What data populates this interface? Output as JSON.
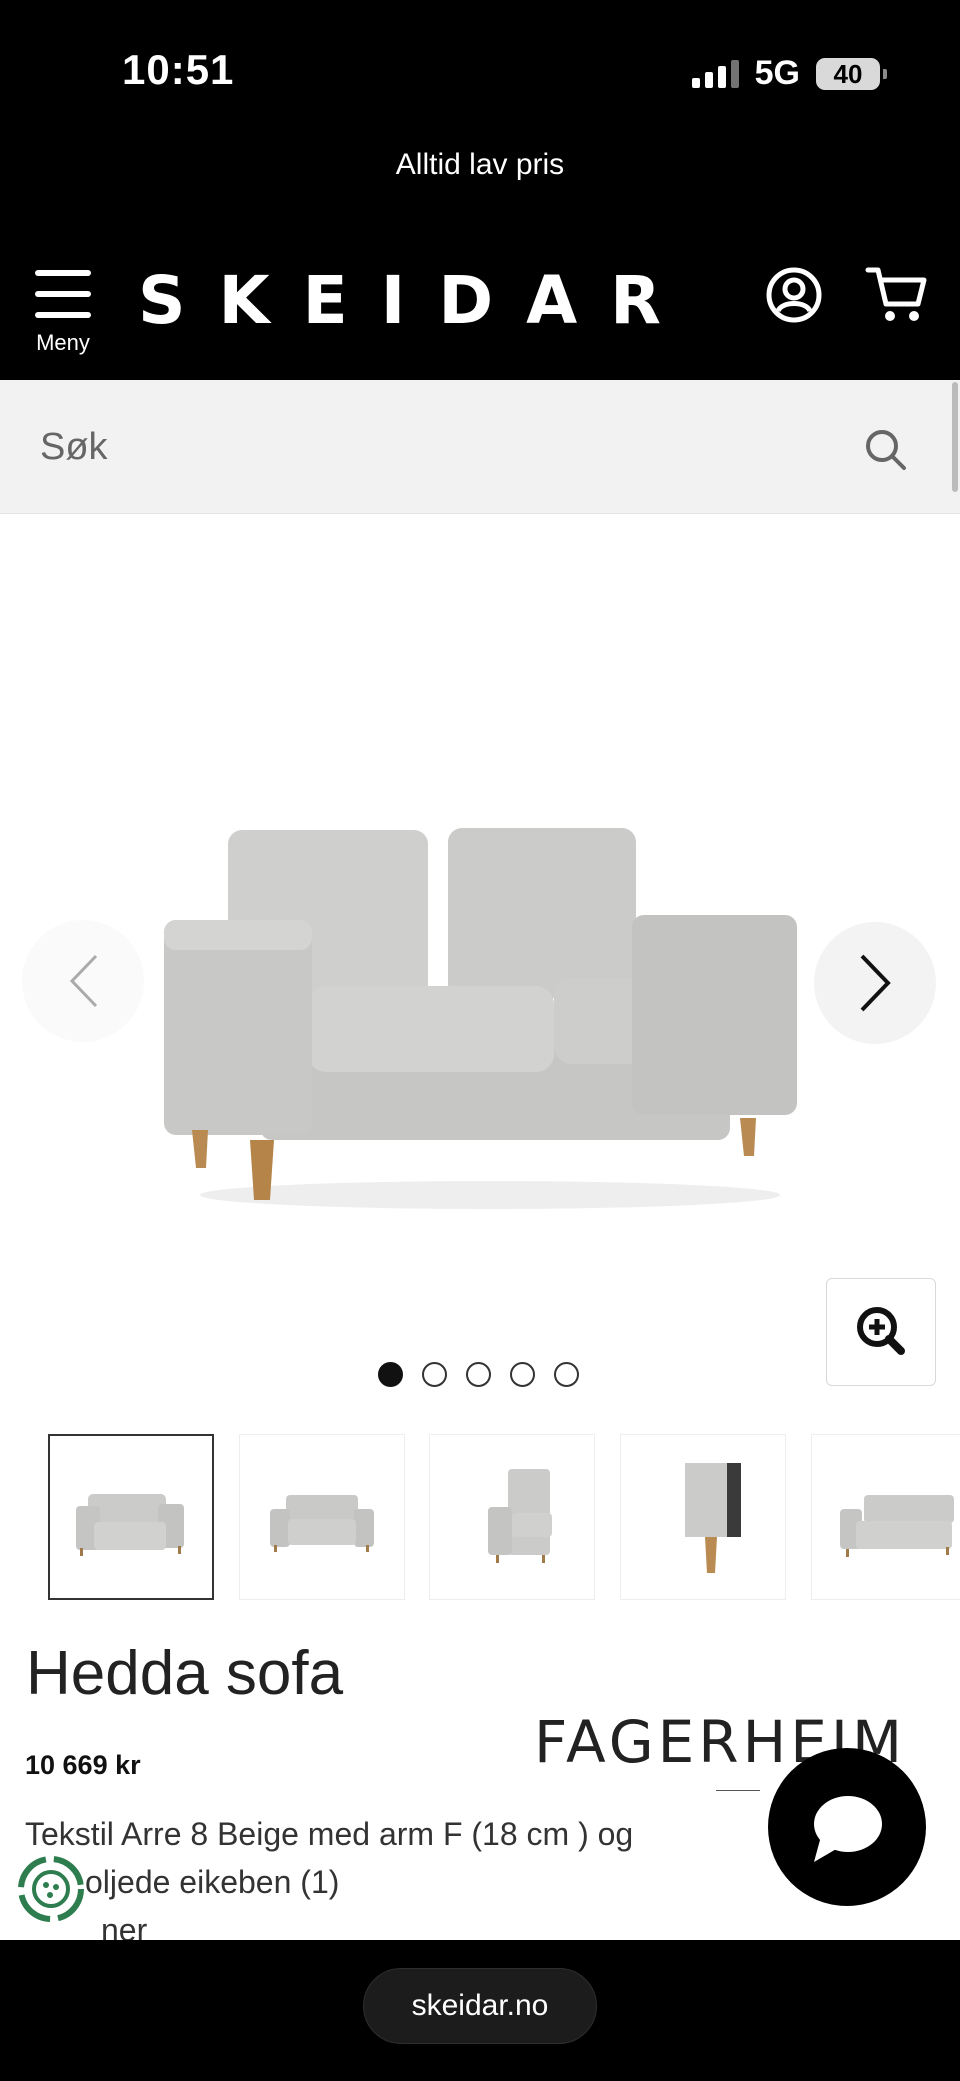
{
  "status_bar": {
    "time": "10:51",
    "network": "5G",
    "battery": "40"
  },
  "promo": {
    "text": "Alltid lav pris"
  },
  "header": {
    "menu_label": "Meny",
    "logo": "SKEIDAR"
  },
  "search": {
    "placeholder": "Søk"
  },
  "gallery": {
    "slide_count": 5,
    "active_slide": 1,
    "thumbnails": [
      "front-view",
      "front-view-straight",
      "side-view",
      "leg-detail",
      "angled-view"
    ]
  },
  "product": {
    "title": "Hedda sofa",
    "price": "10 669 kr",
    "brand": "FAGERHEIM",
    "description_line1": "Tekstil Arre 8 Beige med arm F (18 cm ) og",
    "description_line2": "oljede eikeben (1)",
    "description_line3": "ner"
  },
  "browser": {
    "url": "skeidar.no"
  },
  "colors": {
    "header_bg": "#000000",
    "search_bg": "#f2f2f2",
    "sofa": "#c9c9c7",
    "legs": "#b98a52"
  }
}
